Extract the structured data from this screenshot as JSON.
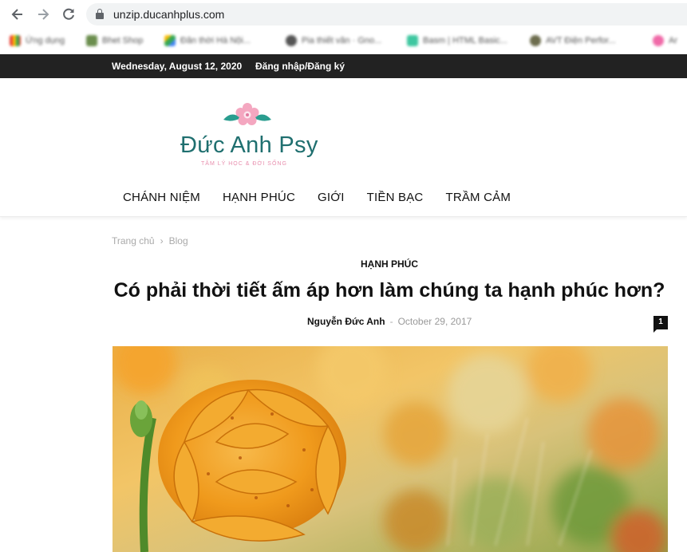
{
  "browser": {
    "url": "unzip.ducanhplus.com",
    "bookmarks": [
      "Ứng dụng",
      "Bhet Shop",
      "Đăn thời Hà Nội...",
      "Pia thiết văn · Gno...",
      "Basm | HTML Basic...",
      "AVT Điện Perfor...",
      "Ar"
    ]
  },
  "topbar": {
    "date": "Wednesday, August 12, 2020",
    "login": "Đăng nhập/Đăng ký"
  },
  "logo": {
    "name": "Đức Anh Psy",
    "tagline": "TÂM LÝ HỌC & ĐỜI SỐNG"
  },
  "menu": [
    "CHÁNH NIỆM",
    "HẠNH PHÚC",
    "GIỚI",
    "TIỀN BẠC",
    "TRẦM CẢM"
  ],
  "breadcrumb": {
    "home": "Trang chủ",
    "separator": "›",
    "current": "Blog"
  },
  "article": {
    "category": "HẠNH PHÚC",
    "title": "Có phải thời tiết ấm áp hơn làm chúng ta hạnh phúc hơn?",
    "author": "Nguyễn Đức Anh",
    "separator": "-",
    "date": "October 29, 2017",
    "comments": "1"
  },
  "colors": {
    "brand": "#1f6f6f",
    "tagline": "#e88fae",
    "topbar": "#222222",
    "flower": "#f3a21c"
  },
  "icons": {
    "back": "arrow-left-icon",
    "forward": "arrow-right-icon",
    "reload": "reload-icon",
    "lock": "lock-icon"
  }
}
